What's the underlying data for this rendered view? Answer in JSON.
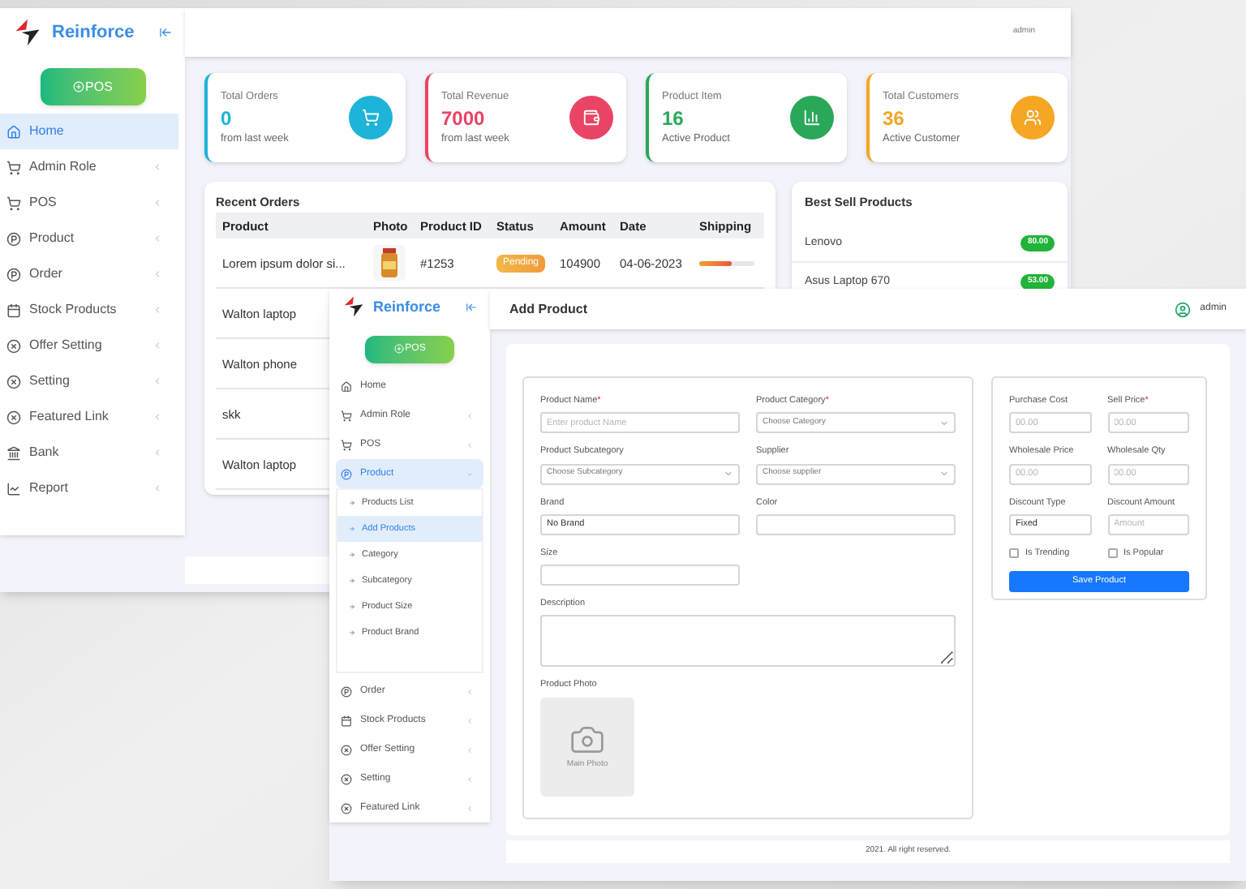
{
  "dashboard": {
    "brand": "Reinforce",
    "pos_button": "POS",
    "user": "admin",
    "nav": [
      {
        "label": "Home",
        "selected": true
      },
      {
        "label": "Admin Role",
        "selected": false
      },
      {
        "label": "POS",
        "selected": false
      },
      {
        "label": "Product",
        "selected": false
      },
      {
        "label": "Order",
        "selected": false
      },
      {
        "label": "Stock Products",
        "selected": false
      },
      {
        "label": "Offer Setting",
        "selected": false
      },
      {
        "label": "Setting",
        "selected": false
      },
      {
        "label": "Featured Link",
        "selected": false
      },
      {
        "label": "Bank",
        "selected": false
      },
      {
        "label": "Report",
        "selected": false
      }
    ],
    "stats": [
      {
        "title": "Total Orders",
        "value": "0",
        "note": "from last week",
        "color": "#1eb3d8"
      },
      {
        "title": "Total Revenue",
        "value": "7000",
        "note": "from last week",
        "color": "#e94464"
      },
      {
        "title": "Product Item",
        "value": "16",
        "note": "Active Product",
        "color": "#2aa85a"
      },
      {
        "title": "Total Customers",
        "value": "36",
        "note": "Active Customer",
        "color": "#f5a623"
      }
    ],
    "recent_orders": {
      "title": "Recent Orders",
      "columns": [
        "Product",
        "Photo",
        "Product ID",
        "Status",
        "Amount",
        "Date",
        "Shipping"
      ],
      "rows": [
        {
          "product": "Lorem ipsum dolor si...",
          "id": "#1253",
          "status": "Pending",
          "amount": "104900",
          "date": "04-06-2023",
          "shipping": {
            "level": 0.6
          }
        },
        {
          "product": "Walton laptop"
        },
        {
          "product": "Walton phone"
        },
        {
          "product": "skk"
        },
        {
          "product": "Walton laptop"
        }
      ]
    },
    "best_sell": {
      "title": "Best Sell Products",
      "items": [
        {
          "name": "Lenovo",
          "price": "80.00"
        },
        {
          "name": "Asus Laptop 670",
          "price": "53.00"
        }
      ]
    }
  },
  "add_product": {
    "brand": "Reinforce",
    "pos_button": "POS",
    "title": "Add Product",
    "user": "admin",
    "nav": [
      {
        "label": "Home",
        "selected": false
      },
      {
        "label": "Admin Role",
        "selected": false,
        "expanded": false
      },
      {
        "label": "POS",
        "selected": false,
        "expanded": false
      },
      {
        "label": "Product",
        "selected": true,
        "expanded": true,
        "children": [
          {
            "label": "Products List",
            "selected": false
          },
          {
            "label": "Add Products",
            "selected": true
          },
          {
            "label": "Category",
            "selected": false
          },
          {
            "label": "Subcategory",
            "selected": false
          },
          {
            "label": "Product Size",
            "selected": false
          },
          {
            "label": "Product Brand",
            "selected": false
          }
        ]
      },
      {
        "label": "Order",
        "selected": false,
        "expanded": false
      },
      {
        "label": "Stock Products",
        "selected": false,
        "expanded": false
      },
      {
        "label": "Offer Setting",
        "selected": false,
        "expanded": false
      },
      {
        "label": "Setting",
        "selected": false,
        "expanded": false
      },
      {
        "label": "Featured Link",
        "selected": false,
        "expanded": false
      }
    ],
    "fields": [
      {
        "kind": "text",
        "label": "Product Name",
        "required_mark": "*",
        "placeholder": "Enter product Name"
      },
      {
        "kind": "select",
        "label": "Product Category",
        "required_mark": "*",
        "placeholder": "Choose Category"
      },
      {
        "kind": "select",
        "label": "Product Subcategory",
        "placeholder": "Choose Subcategory"
      },
      {
        "kind": "select",
        "label": "Supplier",
        "placeholder": "Choose supplier"
      },
      {
        "kind": "text",
        "label": "Brand",
        "value": "No Brand"
      },
      {
        "kind": "text",
        "label": "Color"
      },
      {
        "kind": "text",
        "label": "Size"
      },
      {
        "kind": "gap"
      },
      {
        "kind": "textarea",
        "label": "Description"
      },
      {
        "label": "Product Photo",
        "caption": "Main Photo"
      }
    ],
    "price_fields": [
      {
        "kind": "text",
        "label": "Purchase Cost",
        "placeholder": "00.00"
      },
      {
        "kind": "text",
        "label": "Sell Price",
        "required_mark": "*",
        "placeholder": "00.00"
      },
      {
        "kind": "text",
        "label": "Wholesale Price",
        "placeholder": "00.00"
      },
      {
        "kind": "text",
        "label": "Wholesale Qty",
        "placeholder": "00.00"
      },
      {
        "kind": "text",
        "label": "Discount Type",
        "value": "Fixed"
      },
      {
        "kind": "text",
        "label": "Discount Amount",
        "placeholder": "Amount"
      },
      {
        "kind": "checkbox",
        "label": "Is Trending",
        "checked": false
      },
      {
        "kind": "checkbox",
        "label": "Is Popular",
        "checked": false
      }
    ],
    "save_button": "Save Product",
    "footer": "2021. All right reserved."
  }
}
